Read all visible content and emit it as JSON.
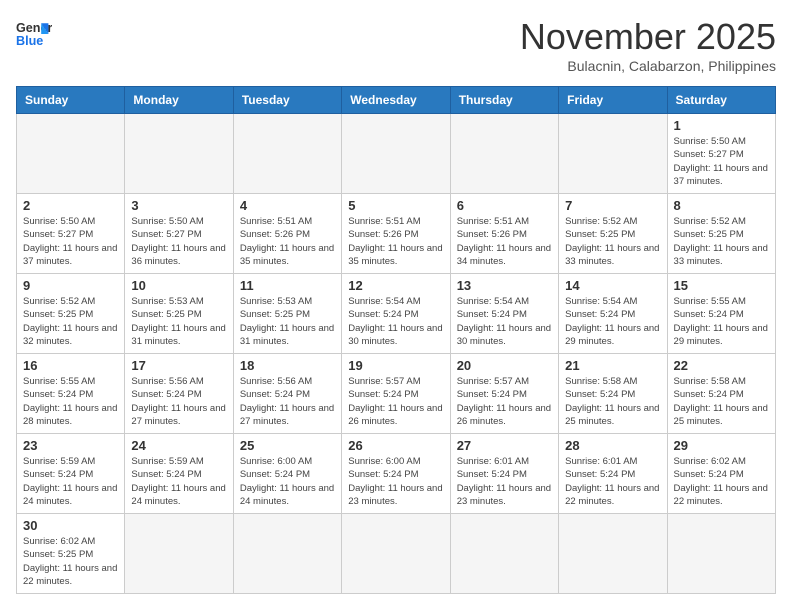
{
  "logo": {
    "line1": "General",
    "line2": "Blue"
  },
  "title": "November 2025",
  "location": "Bulacnin, Calabarzon, Philippines",
  "days_of_week": [
    "Sunday",
    "Monday",
    "Tuesday",
    "Wednesday",
    "Thursday",
    "Friday",
    "Saturday"
  ],
  "weeks": [
    [
      {
        "day": "",
        "info": ""
      },
      {
        "day": "",
        "info": ""
      },
      {
        "day": "",
        "info": ""
      },
      {
        "day": "",
        "info": ""
      },
      {
        "day": "",
        "info": ""
      },
      {
        "day": "",
        "info": ""
      },
      {
        "day": "1",
        "info": "Sunrise: 5:50 AM\nSunset: 5:27 PM\nDaylight: 11 hours and 37 minutes."
      }
    ],
    [
      {
        "day": "2",
        "info": "Sunrise: 5:50 AM\nSunset: 5:27 PM\nDaylight: 11 hours and 37 minutes."
      },
      {
        "day": "3",
        "info": "Sunrise: 5:50 AM\nSunset: 5:27 PM\nDaylight: 11 hours and 36 minutes."
      },
      {
        "day": "4",
        "info": "Sunrise: 5:51 AM\nSunset: 5:26 PM\nDaylight: 11 hours and 35 minutes."
      },
      {
        "day": "5",
        "info": "Sunrise: 5:51 AM\nSunset: 5:26 PM\nDaylight: 11 hours and 35 minutes."
      },
      {
        "day": "6",
        "info": "Sunrise: 5:51 AM\nSunset: 5:26 PM\nDaylight: 11 hours and 34 minutes."
      },
      {
        "day": "7",
        "info": "Sunrise: 5:52 AM\nSunset: 5:25 PM\nDaylight: 11 hours and 33 minutes."
      },
      {
        "day": "8",
        "info": "Sunrise: 5:52 AM\nSunset: 5:25 PM\nDaylight: 11 hours and 33 minutes."
      }
    ],
    [
      {
        "day": "9",
        "info": "Sunrise: 5:52 AM\nSunset: 5:25 PM\nDaylight: 11 hours and 32 minutes."
      },
      {
        "day": "10",
        "info": "Sunrise: 5:53 AM\nSunset: 5:25 PM\nDaylight: 11 hours and 31 minutes."
      },
      {
        "day": "11",
        "info": "Sunrise: 5:53 AM\nSunset: 5:25 PM\nDaylight: 11 hours and 31 minutes."
      },
      {
        "day": "12",
        "info": "Sunrise: 5:54 AM\nSunset: 5:24 PM\nDaylight: 11 hours and 30 minutes."
      },
      {
        "day": "13",
        "info": "Sunrise: 5:54 AM\nSunset: 5:24 PM\nDaylight: 11 hours and 30 minutes."
      },
      {
        "day": "14",
        "info": "Sunrise: 5:54 AM\nSunset: 5:24 PM\nDaylight: 11 hours and 29 minutes."
      },
      {
        "day": "15",
        "info": "Sunrise: 5:55 AM\nSunset: 5:24 PM\nDaylight: 11 hours and 29 minutes."
      }
    ],
    [
      {
        "day": "16",
        "info": "Sunrise: 5:55 AM\nSunset: 5:24 PM\nDaylight: 11 hours and 28 minutes."
      },
      {
        "day": "17",
        "info": "Sunrise: 5:56 AM\nSunset: 5:24 PM\nDaylight: 11 hours and 27 minutes."
      },
      {
        "day": "18",
        "info": "Sunrise: 5:56 AM\nSunset: 5:24 PM\nDaylight: 11 hours and 27 minutes."
      },
      {
        "day": "19",
        "info": "Sunrise: 5:57 AM\nSunset: 5:24 PM\nDaylight: 11 hours and 26 minutes."
      },
      {
        "day": "20",
        "info": "Sunrise: 5:57 AM\nSunset: 5:24 PM\nDaylight: 11 hours and 26 minutes."
      },
      {
        "day": "21",
        "info": "Sunrise: 5:58 AM\nSunset: 5:24 PM\nDaylight: 11 hours and 25 minutes."
      },
      {
        "day": "22",
        "info": "Sunrise: 5:58 AM\nSunset: 5:24 PM\nDaylight: 11 hours and 25 minutes."
      }
    ],
    [
      {
        "day": "23",
        "info": "Sunrise: 5:59 AM\nSunset: 5:24 PM\nDaylight: 11 hours and 24 minutes."
      },
      {
        "day": "24",
        "info": "Sunrise: 5:59 AM\nSunset: 5:24 PM\nDaylight: 11 hours and 24 minutes."
      },
      {
        "day": "25",
        "info": "Sunrise: 6:00 AM\nSunset: 5:24 PM\nDaylight: 11 hours and 24 minutes."
      },
      {
        "day": "26",
        "info": "Sunrise: 6:00 AM\nSunset: 5:24 PM\nDaylight: 11 hours and 23 minutes."
      },
      {
        "day": "27",
        "info": "Sunrise: 6:01 AM\nSunset: 5:24 PM\nDaylight: 11 hours and 23 minutes."
      },
      {
        "day": "28",
        "info": "Sunrise: 6:01 AM\nSunset: 5:24 PM\nDaylight: 11 hours and 22 minutes."
      },
      {
        "day": "29",
        "info": "Sunrise: 6:02 AM\nSunset: 5:24 PM\nDaylight: 11 hours and 22 minutes."
      }
    ],
    [
      {
        "day": "30",
        "info": "Sunrise: 6:02 AM\nSunset: 5:25 PM\nDaylight: 11 hours and 22 minutes."
      },
      {
        "day": "",
        "info": ""
      },
      {
        "day": "",
        "info": ""
      },
      {
        "day": "",
        "info": ""
      },
      {
        "day": "",
        "info": ""
      },
      {
        "day": "",
        "info": ""
      },
      {
        "day": "",
        "info": ""
      }
    ]
  ]
}
